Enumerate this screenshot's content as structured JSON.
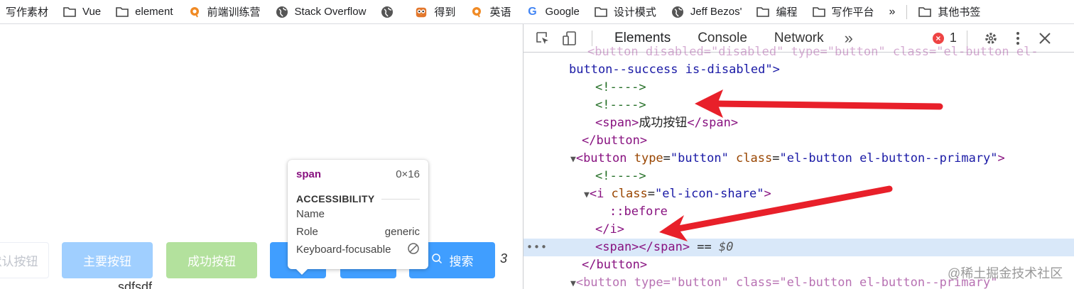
{
  "bookmarks": {
    "items": [
      {
        "label": "写作素材",
        "icon": "none"
      },
      {
        "label": "Vue",
        "icon": "folder-icon"
      },
      {
        "label": "element",
        "icon": "folder-icon"
      },
      {
        "label": "前端训练营",
        "icon": "orange-q-icon"
      },
      {
        "label": "Stack Overflow",
        "icon": "globe-icon"
      },
      {
        "label": "",
        "icon": "globe-icon"
      },
      {
        "label": "得到",
        "icon": "owl-icon"
      },
      {
        "label": "英语",
        "icon": "orange-q-icon"
      },
      {
        "label": "Google",
        "icon": "google-g-icon"
      },
      {
        "label": "设计模式",
        "icon": "folder-icon"
      },
      {
        "label": "Jeff Bezos'",
        "icon": "globe-icon"
      },
      {
        "label": "编程",
        "icon": "folder-icon"
      },
      {
        "label": "写作平台",
        "icon": "folder-icon"
      }
    ],
    "more": "»",
    "other": "其他书签"
  },
  "page": {
    "buttons": {
      "plain_disabled": "默认按钮",
      "primary_disabled": "主要按钮",
      "success_disabled": "成功按钮",
      "search": "搜索"
    },
    "after_number": "3",
    "below_text": "sdfsdf"
  },
  "tooltip": {
    "tag": "span",
    "size": "0×16",
    "section": "ACCESSIBILITY",
    "rows": [
      {
        "label": "Name",
        "value": ""
      },
      {
        "label": "Role",
        "value": "generic"
      },
      {
        "label": "Keyboard-focusable",
        "value": ""
      }
    ]
  },
  "devtools": {
    "tabs": [
      "Elements",
      "Console",
      "Network"
    ],
    "more_tabs": "»",
    "error_count": "1",
    "code_lines": {
      "l0": "button--success is-disabled\">",
      "l1": "<!---->",
      "l2": "<!---->",
      "l3_open": "<span>",
      "l3_text": "成功按钮",
      "l3_close": "</span>",
      "l4": "</button>",
      "l5_tag": "<button",
      "l5_attr1": " type",
      "l5_val1": "\"button\"",
      "l5_attr2": " class",
      "l5_val2": "\"el-button el-button--primary\"",
      "l5_end": ">",
      "l6": "<!---->",
      "l7_tag": "<i",
      "l7_attr": " class",
      "l7_val": "\"el-icon-share\"",
      "l7_end": ">",
      "l8": "::before",
      "l9": "</i>",
      "l10": "<span></span>",
      "l10_suffix": " == ",
      "l10_dollar": "$0",
      "l11": "</button>"
    }
  },
  "watermark": "@稀土掘金技术社区",
  "colors": {
    "primary": "#409eff",
    "primary_disabled": "#a0cfff",
    "success_disabled": "#b3e19d",
    "arrow": "#e8202a",
    "selected_row": "#d9e8f9"
  }
}
